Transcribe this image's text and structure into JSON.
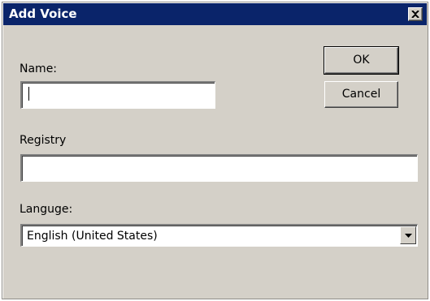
{
  "window": {
    "title": "Add Voice"
  },
  "form": {
    "name_label": "Name:",
    "name_value": "",
    "registry_label": "Registry",
    "registry_value": "",
    "language_label": "Languge:",
    "language_selected": "English (United States)"
  },
  "buttons": {
    "ok_label": "OK",
    "cancel_label": "Cancel"
  },
  "icons": {
    "close": "close-icon",
    "dropdown": "chevron-down-icon"
  },
  "colors": {
    "titlebar": "#0a246a",
    "face": "#d4d0c8"
  }
}
